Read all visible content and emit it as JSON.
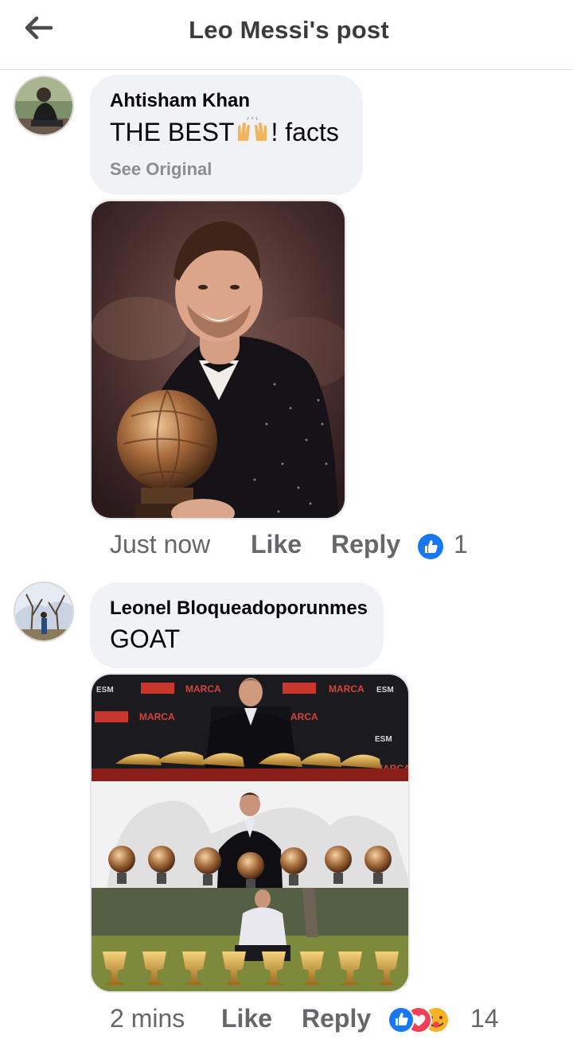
{
  "header": {
    "title": "Leo Messi's post"
  },
  "comments": [
    {
      "author": "Ahtisham Khan",
      "text_before": "THE BEST",
      "text_after": "! facts",
      "see_original": "See Original",
      "time": "Just now",
      "like_label": "Like",
      "reply_label": "Reply",
      "reaction_count": "1",
      "reactions": [
        "like-icon"
      ]
    },
    {
      "author": "Leonel Bloqueadoporunmes",
      "text": "GOAT",
      "time": "2 mins",
      "like_label": "Like",
      "reply_label": "Reply",
      "reaction_count": "14",
      "reactions": [
        "like-icon",
        "love-icon",
        "care-icon"
      ]
    }
  ],
  "colors": {
    "like_blue": "#1877f2",
    "love_red": "#f33e58",
    "care_yellow": "#f7b125",
    "bubble": "#f0f2f5",
    "muted": "#65676b"
  }
}
